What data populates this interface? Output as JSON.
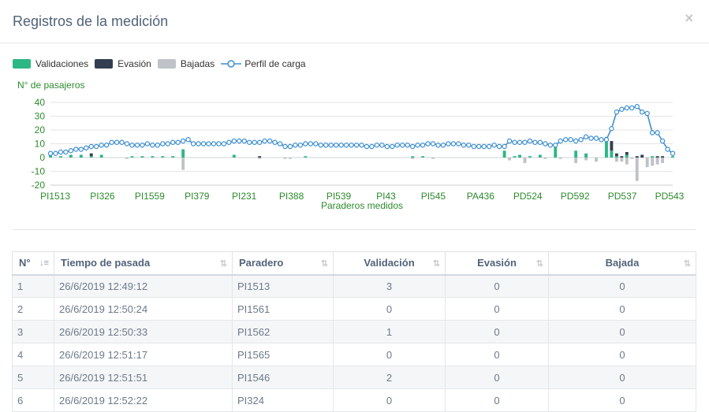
{
  "modal": {
    "title": "Registros de la medición",
    "close_label": "×"
  },
  "legend": [
    {
      "label": "Validaciones",
      "color": "#2cb784"
    },
    {
      "label": "Evasión",
      "color": "#333f50"
    },
    {
      "label": "Bajadas",
      "color": "#bfc3c7"
    },
    {
      "label": "Perfil de carga",
      "color": "#3d8fd1"
    }
  ],
  "chart_data": {
    "type": "bar",
    "ylabel": "N° de pasajeros",
    "xlabel": "Paraderos medidos",
    "ylim": [
      -20,
      40
    ],
    "yticks": [
      40,
      30,
      20,
      10,
      0,
      -10,
      -20
    ],
    "xtick_labels": [
      "PI1513",
      "PI326",
      "PI1559",
      "PI379",
      "PI231",
      "PI388",
      "PI539",
      "PI43",
      "PI545",
      "PA436",
      "PD524",
      "PD592",
      "PD537",
      "PD543"
    ],
    "series": [
      {
        "name": "Validaciones",
        "values": [
          3,
          0,
          1,
          0,
          2,
          0,
          2,
          0,
          1,
          0,
          2,
          0,
          0,
          0,
          0,
          0,
          1,
          0,
          1,
          0,
          1,
          0,
          1,
          0,
          1,
          0,
          6,
          0,
          0,
          0,
          0,
          0,
          0,
          0,
          0,
          0,
          2,
          0,
          0,
          0,
          0,
          0,
          0,
          0,
          0,
          0,
          0,
          0,
          0,
          0,
          1,
          0,
          0,
          0,
          0,
          0,
          0,
          0,
          0,
          0,
          0,
          0,
          0,
          0,
          0,
          0,
          0,
          0,
          0,
          0,
          0,
          1,
          0,
          1,
          0,
          0,
          0,
          0,
          0,
          0,
          0,
          0,
          0,
          0,
          0,
          0,
          0,
          0,
          0,
          5,
          0,
          1,
          2,
          0,
          1,
          0,
          2,
          0,
          0,
          9,
          0,
          0,
          0,
          5,
          0,
          3,
          0,
          0,
          0,
          15,
          5,
          1,
          0,
          2,
          0,
          0,
          0,
          0,
          1,
          0,
          0,
          0,
          1
        ]
      },
      {
        "name": "Evasión",
        "values": [
          0,
          0,
          0,
          0,
          0,
          0,
          0,
          0,
          2,
          0,
          0,
          0,
          0,
          0,
          0,
          0,
          0,
          0,
          0,
          0,
          0,
          0,
          0,
          0,
          0,
          0,
          0,
          0,
          0,
          0,
          0,
          0,
          0,
          0,
          0,
          0,
          0,
          0,
          0,
          0,
          0,
          1,
          0,
          0,
          0,
          0,
          0,
          0,
          0,
          0,
          0,
          0,
          0,
          0,
          0,
          0,
          0,
          0,
          0,
          0,
          0,
          0,
          0,
          0,
          0,
          0,
          0,
          0,
          0,
          0,
          0,
          0,
          0,
          0,
          0,
          0,
          0,
          0,
          0,
          0,
          0,
          0,
          0,
          0,
          0,
          0,
          0,
          0,
          0,
          0,
          0,
          0,
          0,
          0,
          0,
          0,
          0,
          0,
          0,
          0,
          0,
          0,
          0,
          0,
          0,
          0,
          0,
          0,
          0,
          0,
          7,
          2,
          1,
          2,
          0,
          1,
          2,
          0,
          0,
          1,
          1,
          0,
          0
        ]
      },
      {
        "name": "Bajadas",
        "values": [
          0,
          0,
          0,
          0,
          0,
          0,
          0,
          0,
          0,
          0,
          0,
          0,
          0,
          0,
          0,
          -1,
          0,
          0,
          0,
          0,
          0,
          0,
          0,
          0,
          0,
          0,
          -9,
          0,
          0,
          0,
          0,
          0,
          0,
          0,
          0,
          0,
          0,
          0,
          0,
          0,
          0,
          -1,
          0,
          0,
          0,
          0,
          -1,
          -1,
          0,
          0,
          0,
          0,
          0,
          0,
          0,
          0,
          0,
          0,
          0,
          0,
          0,
          0,
          0,
          0,
          0,
          0,
          0,
          0,
          0,
          0,
          0,
          -1,
          0,
          0,
          0,
          -1,
          0,
          0,
          0,
          0,
          0,
          0,
          0,
          0,
          0,
          0,
          0,
          0,
          0,
          0,
          -2,
          0,
          0,
          -4,
          0,
          0,
          0,
          -1,
          0,
          0,
          -1,
          0,
          0,
          -4,
          0,
          -2,
          0,
          -3,
          0,
          0,
          0,
          -3,
          -3,
          -5,
          -1,
          -17,
          0,
          -7,
          -6,
          -5,
          -4,
          0
        ]
      },
      {
        "name": "Perfil de carga",
        "values": [
          3,
          3,
          4,
          4,
          5,
          6,
          6,
          7,
          8,
          8,
          9,
          9,
          11,
          11,
          11,
          10,
          9,
          9,
          9,
          10,
          9,
          9,
          10,
          10,
          11,
          11,
          12,
          13,
          10,
          10,
          10,
          10,
          10,
          10,
          10,
          11,
          12,
          12,
          12,
          11,
          11,
          11,
          12,
          12,
          11,
          10,
          8,
          8,
          9,
          9,
          10,
          10,
          10,
          9,
          9,
          9,
          9,
          9,
          9,
          9,
          9,
          9,
          8,
          8,
          9,
          9,
          8,
          8,
          9,
          9,
          9,
          8,
          9,
          9,
          10,
          10,
          9,
          9,
          10,
          10,
          10,
          9,
          9,
          8,
          8,
          8,
          8,
          9,
          8,
          8,
          12,
          11,
          11,
          11,
          12,
          11,
          11,
          10,
          9,
          9,
          12,
          13,
          13,
          12,
          13,
          15,
          14,
          14,
          13,
          13,
          21,
          33,
          35,
          36,
          36,
          37,
          33,
          32,
          18,
          18,
          12,
          6,
          3
        ]
      }
    ]
  },
  "table": {
    "headers": [
      "N°",
      "Tiempo de pasada",
      "Paradero",
      "Validación",
      "Evasión",
      "Bajada"
    ],
    "rows": [
      [
        "1",
        "26/6/2019 12:49:12",
        "PI1513",
        "3",
        "0",
        "0"
      ],
      [
        "2",
        "26/6/2019 12:50:24",
        "PI1561",
        "0",
        "0",
        "0"
      ],
      [
        "3",
        "26/6/2019 12:50:33",
        "PI1562",
        "1",
        "0",
        "0"
      ],
      [
        "4",
        "26/6/2019 12:51:17",
        "PI1565",
        "0",
        "0",
        "0"
      ],
      [
        "5",
        "26/6/2019 12:51:51",
        "PI1546",
        "2",
        "0",
        "0"
      ],
      [
        "6",
        "26/6/2019 12:52:22",
        "PI324",
        "0",
        "0",
        "0"
      ]
    ]
  }
}
